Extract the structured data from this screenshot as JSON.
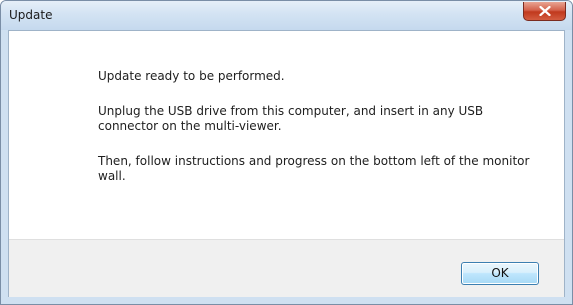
{
  "window": {
    "title": "Update"
  },
  "message": {
    "line1": "Update ready to be performed.",
    "line2": "Unplug the USB drive from this computer, and insert in any USB connector on the multi-viewer.",
    "line3": "Then, follow instructions and progress on the bottom left of the monitor wall."
  },
  "buttons": {
    "ok_label": "OK"
  },
  "icons": {
    "close": "close-icon"
  },
  "colors": {
    "titlebar": "#d3e3f3",
    "close_button": "#c1391d",
    "footer": "#f0f0f0"
  }
}
